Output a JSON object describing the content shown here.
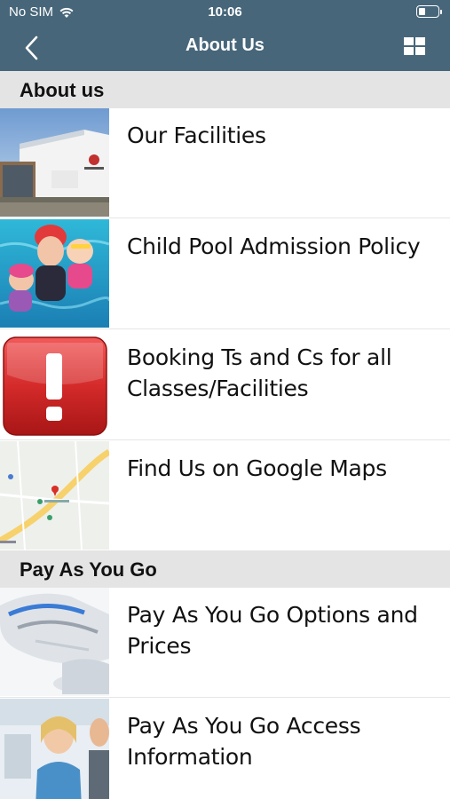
{
  "status_bar": {
    "carrier": "No SIM",
    "time": "10:06",
    "battery_level": 0.35
  },
  "nav": {
    "title": "About Us",
    "back_icon": "chevron-left-icon",
    "menu_icon": "grid-icon"
  },
  "sections": [
    {
      "header": "About us",
      "items": [
        {
          "label": "Our Facilities",
          "thumbnail": "building-photo"
        },
        {
          "label": "Child Pool Admission Policy",
          "thumbnail": "swimming-family-photo"
        },
        {
          "label": "Booking Ts and Cs for all Classes/Facilities",
          "thumbnail": "warning-icon"
        },
        {
          "label": "Find Us on Google Maps",
          "thumbnail": "map-image"
        }
      ]
    },
    {
      "header": "Pay As You Go",
      "items": [
        {
          "label": "Pay As You Go Options and Prices",
          "thumbnail": "trainers-photo"
        },
        {
          "label": "Pay As You Go Access Information",
          "thumbnail": "gym-people-photo"
        }
      ]
    }
  ],
  "colors": {
    "nav_bar": "#47667a",
    "section_header": "#e4e4e4",
    "warning_red": "#d42a2a"
  }
}
